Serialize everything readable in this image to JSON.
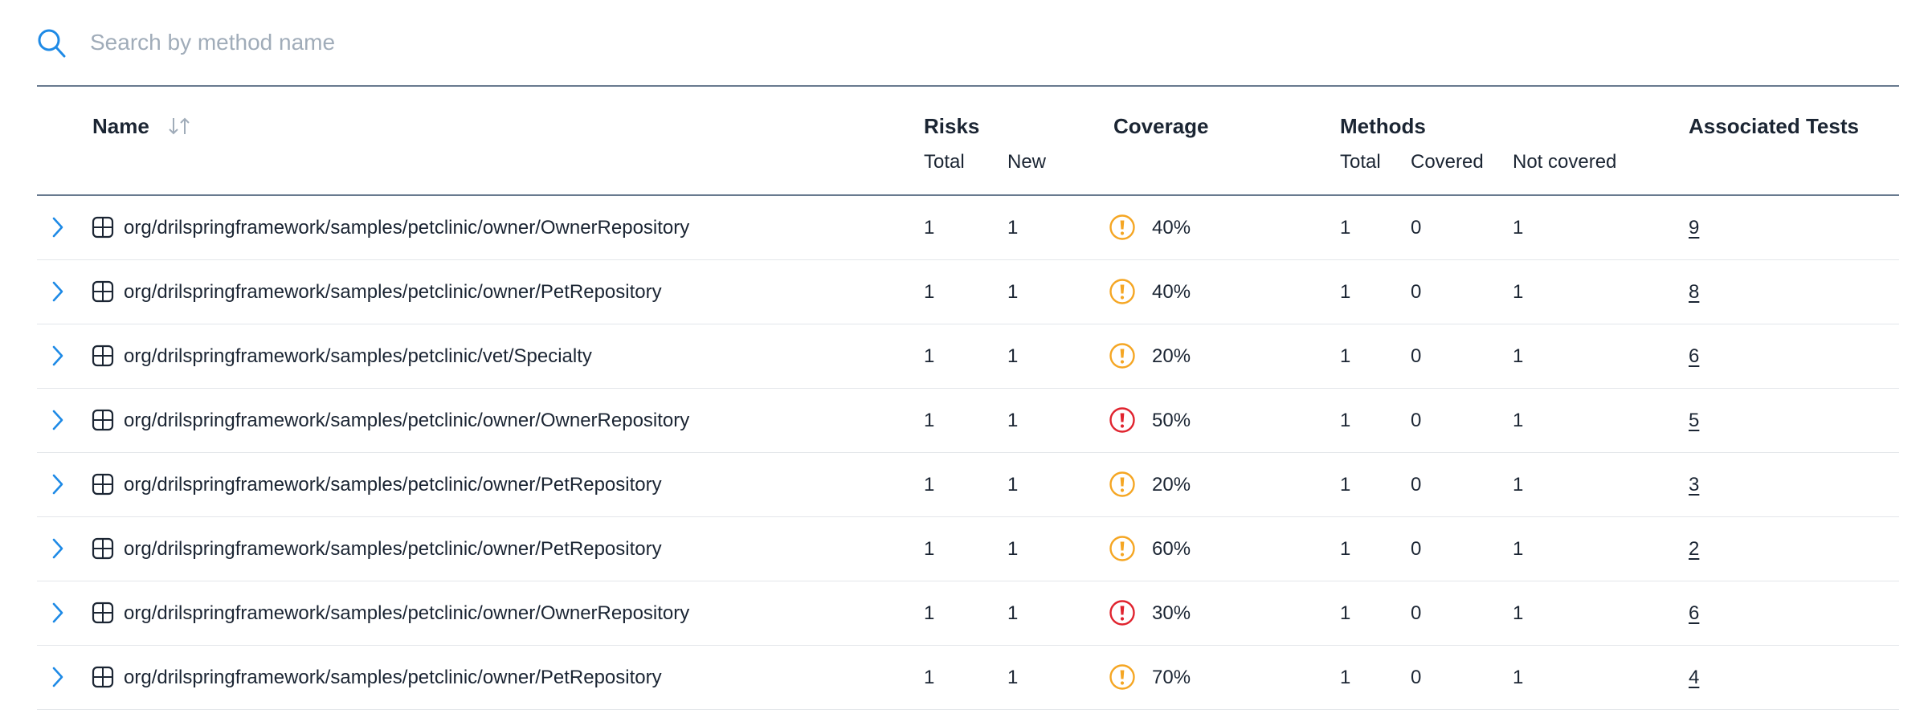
{
  "search": {
    "placeholder": "Search by method name",
    "value": ""
  },
  "columns": {
    "name": "Name",
    "risks": "Risks",
    "risks_total": "Total",
    "risks_new": "New",
    "coverage": "Coverage",
    "methods": "Methods",
    "methods_total": "Total",
    "methods_covered": "Covered",
    "methods_not_covered": "Not covered",
    "associated_tests": "Associated Tests"
  },
  "colors": {
    "accent": "#1e8ae6",
    "warning": "#f5a623",
    "danger": "#e0232e",
    "text": "#1b2533",
    "divider": "#687a8f"
  },
  "rows": [
    {
      "name": "org/drilspringframework/samples/petclinic/owner/OwnerRepository",
      "risks_total": "1",
      "risks_new": "1",
      "coverage": "40%",
      "level": "warning",
      "methods_total": "1",
      "covered": "0",
      "not_covered": "1",
      "tests": "9"
    },
    {
      "name": "org/drilspringframework/samples/petclinic/owner/PetRepository",
      "risks_total": "1",
      "risks_new": "1",
      "coverage": "40%",
      "level": "warning",
      "methods_total": "1",
      "covered": "0",
      "not_covered": "1",
      "tests": "8"
    },
    {
      "name": "org/drilspringframework/samples/petclinic/vet/Specialty",
      "risks_total": "1",
      "risks_new": "1",
      "coverage": "20%",
      "level": "warning",
      "methods_total": "1",
      "covered": "0",
      "not_covered": "1",
      "tests": "6"
    },
    {
      "name": "org/drilspringframework/samples/petclinic/owner/OwnerRepository",
      "risks_total": "1",
      "risks_new": "1",
      "coverage": "50%",
      "level": "danger",
      "methods_total": "1",
      "covered": "0",
      "not_covered": "1",
      "tests": "5"
    },
    {
      "name": "org/drilspringframework/samples/petclinic/owner/PetRepository",
      "risks_total": "1",
      "risks_new": "1",
      "coverage": "20%",
      "level": "warning",
      "methods_total": "1",
      "covered": "0",
      "not_covered": "1",
      "tests": "3"
    },
    {
      "name": "org/drilspringframework/samples/petclinic/owner/PetRepository",
      "risks_total": "1",
      "risks_new": "1",
      "coverage": "60%",
      "level": "warning",
      "methods_total": "1",
      "covered": "0",
      "not_covered": "1",
      "tests": "2"
    },
    {
      "name": "org/drilspringframework/samples/petclinic/owner/OwnerRepository",
      "risks_total": "1",
      "risks_new": "1",
      "coverage": "30%",
      "level": "danger",
      "methods_total": "1",
      "covered": "0",
      "not_covered": "1",
      "tests": "6"
    },
    {
      "name": "org/drilspringframework/samples/petclinic/owner/PetRepository",
      "risks_total": "1",
      "risks_new": "1",
      "coverage": "70%",
      "level": "warning",
      "methods_total": "1",
      "covered": "0",
      "not_covered": "1",
      "tests": "4"
    }
  ]
}
